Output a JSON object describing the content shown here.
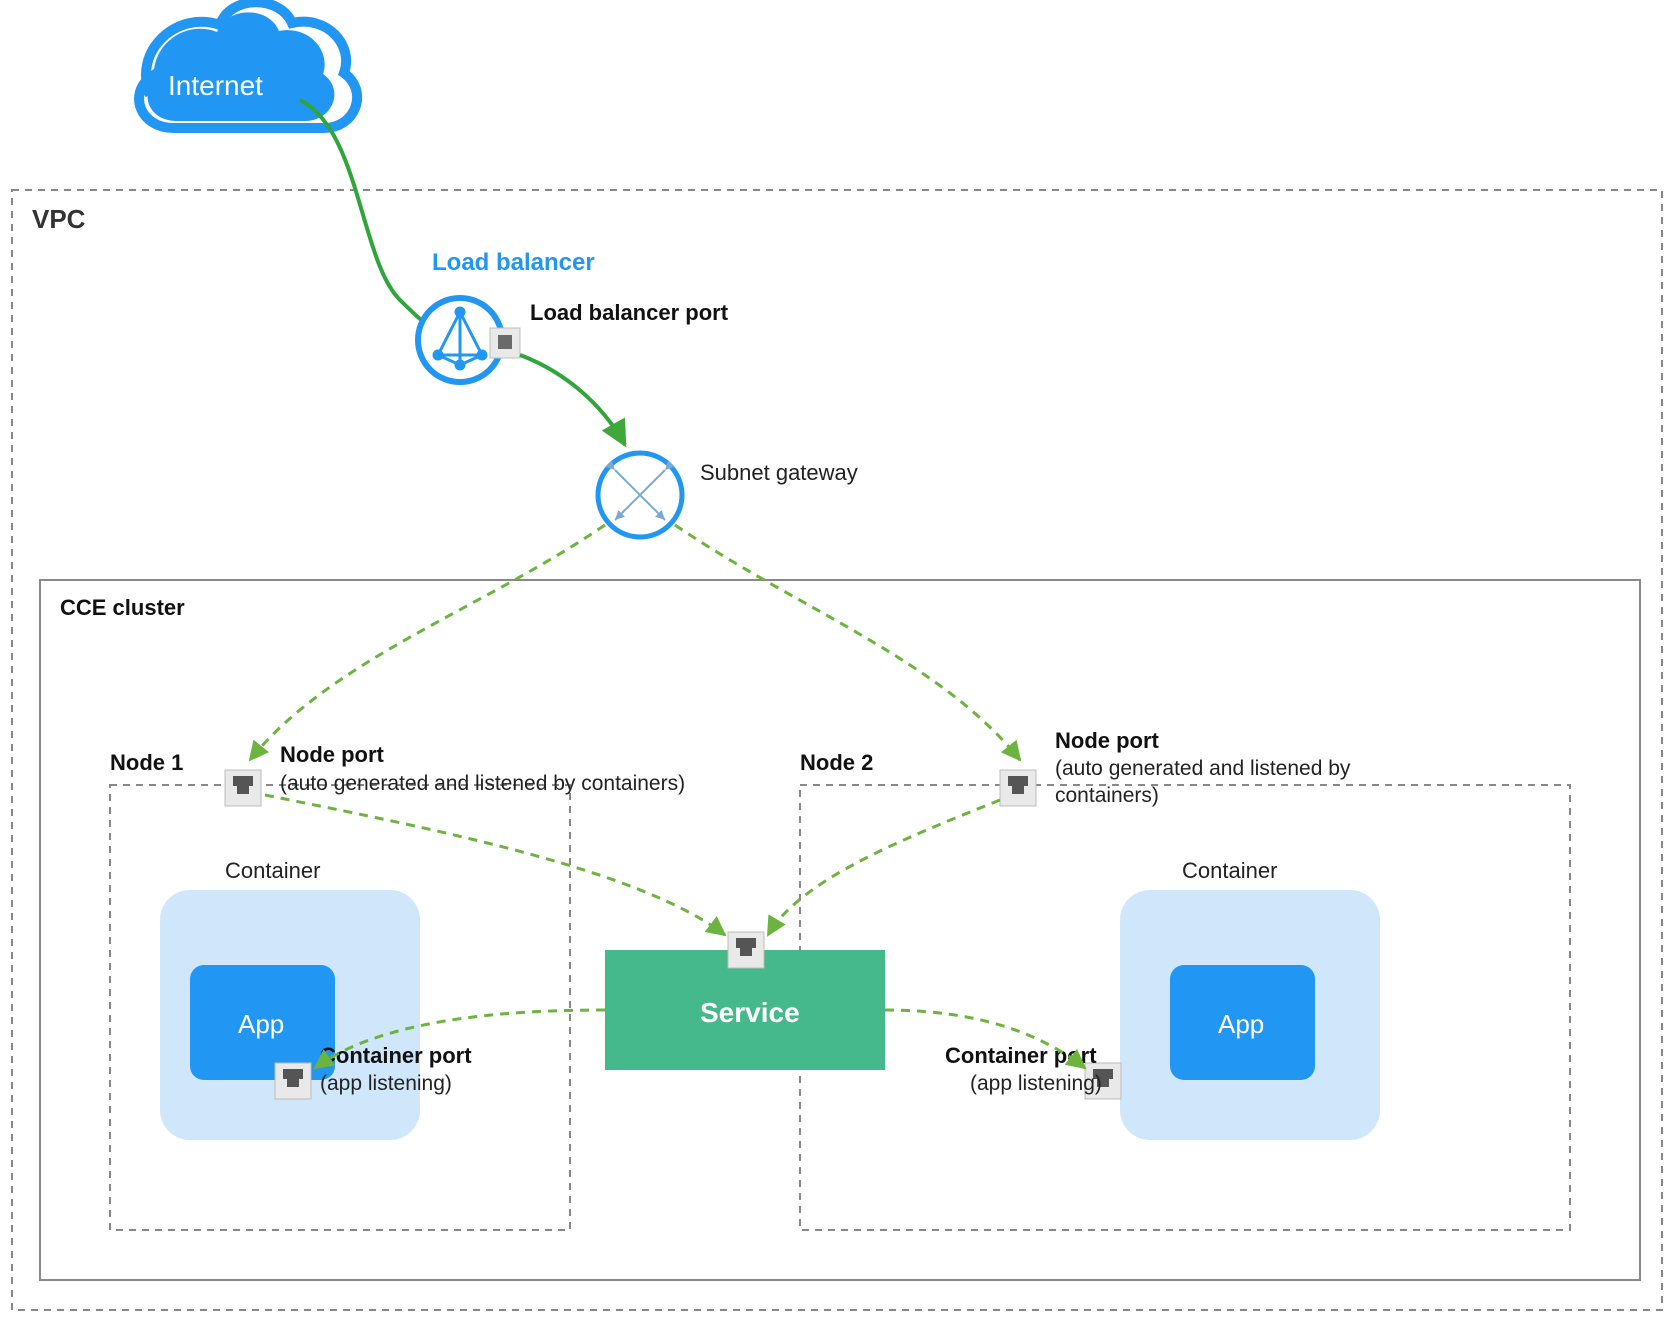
{
  "internet": {
    "label": "Internet"
  },
  "vpc": {
    "title": "VPC"
  },
  "loadBalancer": {
    "title": "Load balancer",
    "portLabel": "Load balancer port"
  },
  "subnetGateway": {
    "label": "Subnet gateway"
  },
  "cluster": {
    "title": "CCE cluster"
  },
  "nodes": [
    {
      "title": "Node 1",
      "portLabel": "Node port",
      "portHint": "(auto generated and listened by containers)",
      "container": {
        "title": "Container",
        "app": "App",
        "portLabel": "Container port",
        "portHint": "(app listening)"
      }
    },
    {
      "title": "Node 2",
      "portLabel": "Node port",
      "portHint1": "(auto generated and listened by",
      "portHint2": "containers)",
      "container": {
        "title": "Container",
        "app": "App",
        "portLabel": "Container port",
        "portHint": "(app listening)"
      }
    }
  ],
  "service": {
    "label": "Service"
  },
  "colors": {
    "blue": "#2196f3",
    "blueLight": "#cfe6fb",
    "green": "#46b98c",
    "arrowGreen": "#5cae3a",
    "gray": "#888",
    "darkGray": "#555",
    "boxGray": "#e9e9e9"
  }
}
